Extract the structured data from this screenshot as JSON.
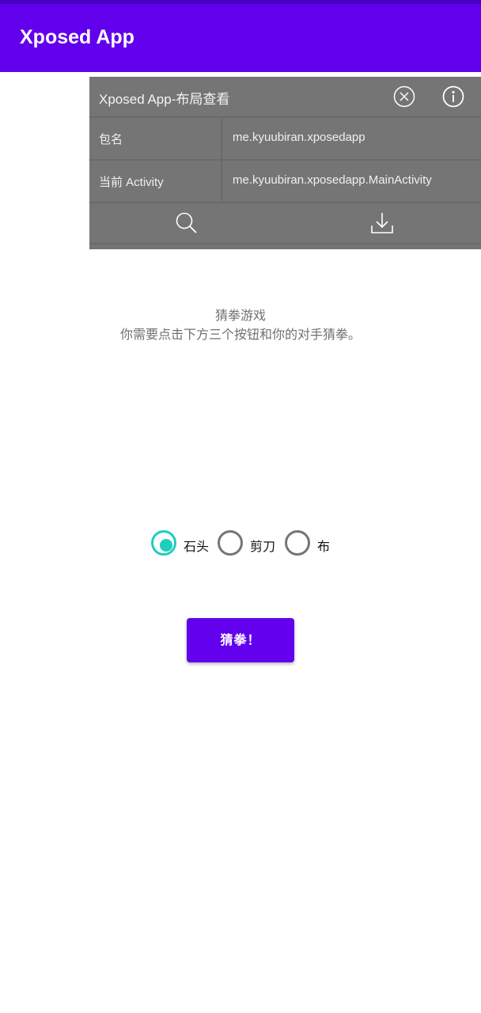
{
  "app_bar": {
    "title": "Xposed App"
  },
  "overlay": {
    "title": "Xposed App-布局查看",
    "rows": [
      {
        "key": "包名",
        "value": "me.kyuubiran.xposedapp"
      },
      {
        "key": "当前 Activity",
        "value": "me.kyuubiran.xposedapp.MainActivity"
      }
    ],
    "icons": [
      "close-circle-icon",
      "info-icon",
      "search-icon",
      "download-icon"
    ]
  },
  "game": {
    "title": "猜拳游戏",
    "description": "你需要点击下方三个按钮和你的对手猜拳。",
    "options": [
      {
        "label": "石头",
        "checked": true
      },
      {
        "label": "剪刀",
        "checked": false
      },
      {
        "label": "布",
        "checked": false
      }
    ],
    "button_label": "猜拳！"
  },
  "colors": {
    "primary": "#6200ee",
    "accent": "#1ccfbd",
    "overlay_bg": "#757575"
  }
}
